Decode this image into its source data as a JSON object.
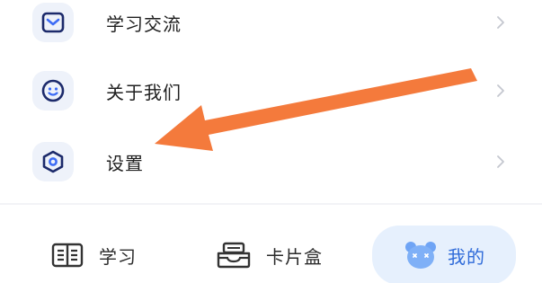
{
  "menu": {
    "items": [
      {
        "label": "学习交流",
        "icon": "mail-icon"
      },
      {
        "label": "关于我们",
        "icon": "smiley-icon"
      },
      {
        "label": "设置",
        "icon": "hexagon-settings-icon"
      }
    ]
  },
  "tabbar": {
    "tabs": [
      {
        "label": "学习",
        "icon": "book-icon",
        "active": false
      },
      {
        "label": "卡片盒",
        "icon": "card-box-icon",
        "active": false
      },
      {
        "label": "我的",
        "icon": "bear-avatar-icon",
        "active": true
      }
    ]
  },
  "annotation": {
    "type": "arrow",
    "color": "#f47a3c",
    "points_to": "设置"
  },
  "colors": {
    "icon_stroke": "#1c2a6b",
    "icon_accent": "#3d6cf5",
    "icon_tile_bg": "#eef2fa",
    "active_tab_bg": "#e6f0fd",
    "active_tab_text": "#2f6bd9",
    "arrow": "#f47a3c"
  }
}
